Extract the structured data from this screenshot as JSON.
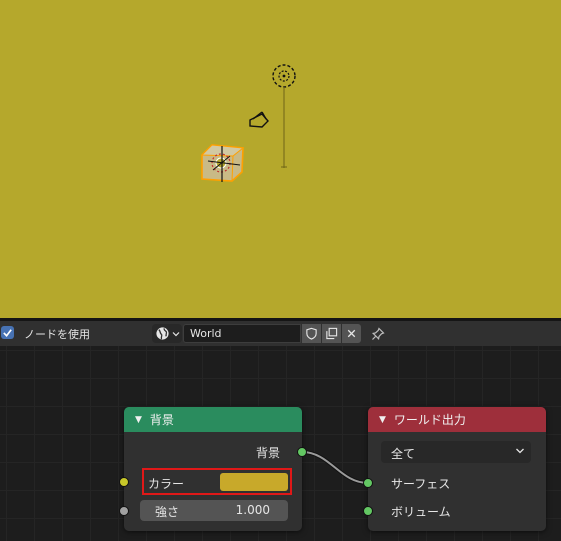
{
  "colors": {
    "world_background": "#b5a82c",
    "background_node_header": "#2a8c5e",
    "world_output_header": "#9e2f3b",
    "shader_socket": "#63c763",
    "color_socket": "#c7c729",
    "float_socket": "#a1a1a1",
    "highlight_box": "#e01818",
    "selection_outline": "#ffa000"
  },
  "header": {
    "use_nodes_label": "ノードを使用",
    "use_nodes_checked": true,
    "world_type_icon": "world-icon",
    "world_name": "World",
    "fake_user_icon": "shield-icon",
    "duplicate_icon": "duplicate-icon",
    "unlink_icon": "close-icon",
    "pin_icon": "pin-icon"
  },
  "nodes": {
    "background": {
      "title": "背景",
      "output_label": "背景",
      "color_label": "カラー",
      "color_value": "#c8a92a",
      "strength_label": "強さ",
      "strength_value": "1.000"
    },
    "world_output": {
      "title": "ワールド出力",
      "target_selected": "全て",
      "surface_label": "サーフェス",
      "volume_label": "ボリューム"
    }
  }
}
